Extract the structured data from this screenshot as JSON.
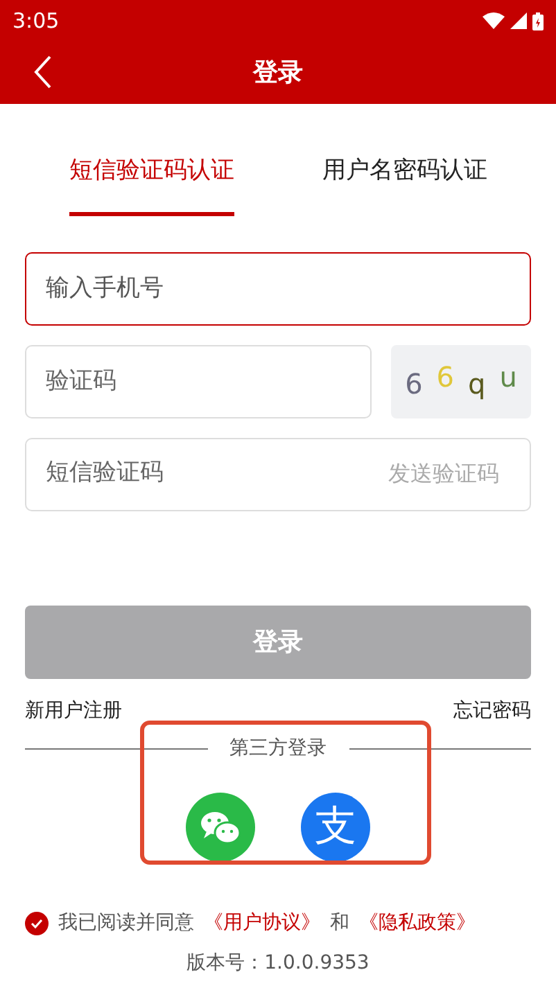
{
  "status_bar": {
    "time": "3:05"
  },
  "header": {
    "title": "登录"
  },
  "tabs": [
    {
      "label": "短信验证码认证",
      "selected": true
    },
    {
      "label": "用户名密码认证",
      "selected": false
    }
  ],
  "phone_field": {
    "placeholder": "输入手机号",
    "focused": true
  },
  "captcha_field": {
    "placeholder": "验证码"
  },
  "captcha_image": {
    "chars": [
      {
        "text": "6",
        "color": "#6b6b80"
      },
      {
        "text": "6",
        "color": "#e0c73a"
      },
      {
        "text": "q",
        "color": "#5a5a1e"
      },
      {
        "text": "u",
        "color": "#5f8a4a"
      }
    ]
  },
  "sms_field": {
    "placeholder": "短信验证码",
    "action": "发送验证码"
  },
  "login_button": {
    "label": "登录",
    "disabled": true
  },
  "links": {
    "register": "新用户注册",
    "forgot": "忘记密码"
  },
  "third_party": {
    "title": "第三方登录",
    "providers": [
      {
        "kind": "wechat"
      },
      {
        "kind": "alipay",
        "glyph": "支"
      }
    ]
  },
  "agreement": {
    "checked": true,
    "text": "我已阅读并同意",
    "link1": "《用户协议》",
    "and": "和",
    "link2": "《隐私政策》"
  },
  "version": "版本号：1.0.0.9353"
}
